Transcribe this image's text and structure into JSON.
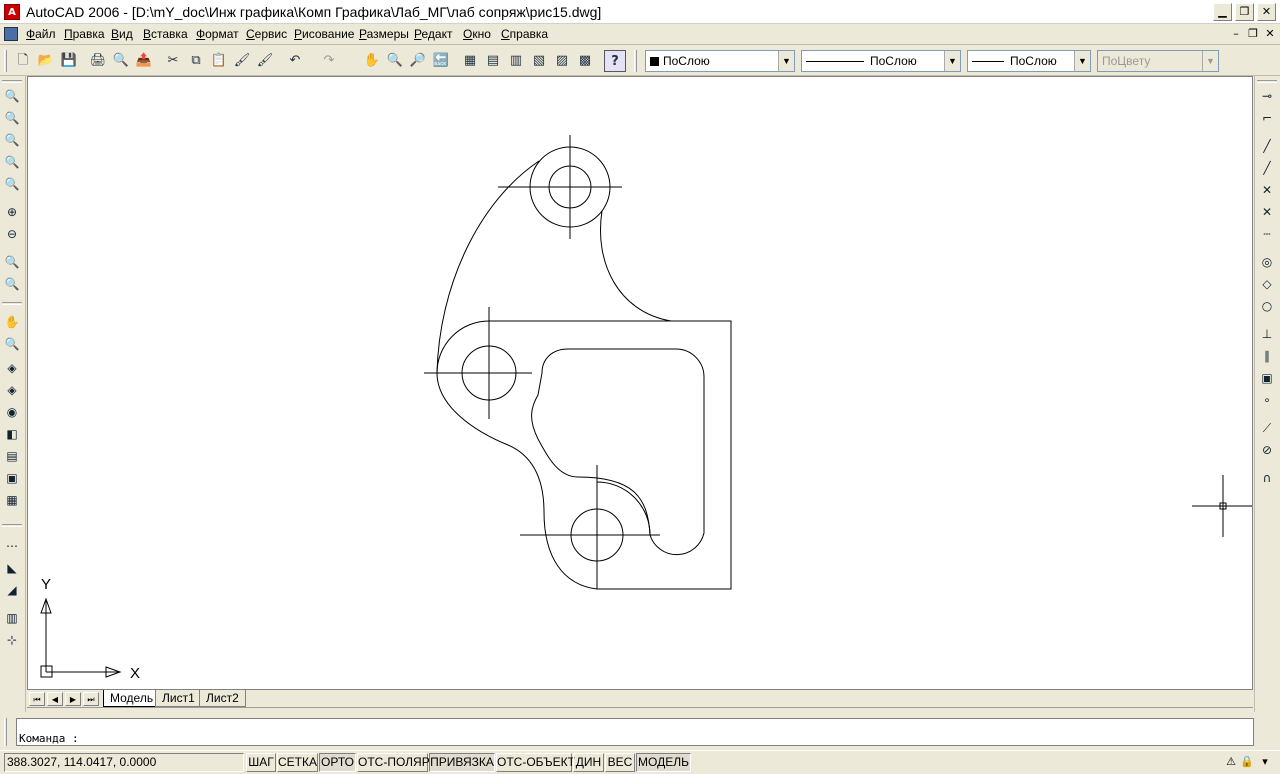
{
  "window": {
    "title": "AutoCAD 2006 - [D:\\mY_doc\\Инж графика\\Комп Графика\\Лаб_МГ\\лаб сопряж\\рис15.dwg]",
    "app_icon": "autocad-icon",
    "minimize": "▁",
    "restore": "❐",
    "close": "✕"
  },
  "menu": {
    "items": [
      "Файл",
      "Правка",
      "Вид",
      "Вставка",
      "Формат",
      "Сервис",
      "Рисование",
      "Размеры",
      "Редакт",
      "Окно",
      "Справка"
    ],
    "doc_minimize": "–",
    "doc_restore": "❐",
    "doc_close": "✕"
  },
  "properties": {
    "layer": "ПоСлою",
    "linetype": "ПоСлою",
    "lineweight": "ПоСлою",
    "plotstyle": "ПоЦвету",
    "layer_swatch_color": "#000000"
  },
  "toolbar_icons": {
    "new": "🗋",
    "open": "📂",
    "save": "💾",
    "plot": "🖨",
    "preview": "🔍",
    "publish": "📤",
    "cut": "✂",
    "copy": "⧉",
    "paste": "📋",
    "match": "🖌",
    "undo": "↶",
    "redo": "↷",
    "pan": "✋",
    "zoom_rt": "🔍",
    "zoom_win": "🔎",
    "zoom_prev": "🔙",
    "props": "▦",
    "design": "▤",
    "tool_palette": "▥",
    "sheetset": "▧",
    "markup": "▨",
    "calc": "▩",
    "help": "?"
  },
  "drawing": {
    "ucs_x": "X",
    "ucs_y": "Y"
  },
  "layout_tabs": [
    "Модель",
    "Лист1",
    "Лист2"
  ],
  "command": {
    "prompt": "Команда :"
  },
  "status": {
    "coords": "388.3027, 114.0417, 0.0000",
    "buttons": [
      "ШАГ",
      "СЕТКА",
      "ОРТО",
      "ОТС-ПОЛЯР",
      "ПРИВЯЗКА",
      "ОТС-ОБЪЕКТ",
      "ДИН",
      "ВЕС",
      "МОДЕЛЬ"
    ],
    "on": [
      "ОРТО",
      "ПРИВЯЗКА",
      "МОДЕЛЬ"
    ]
  }
}
